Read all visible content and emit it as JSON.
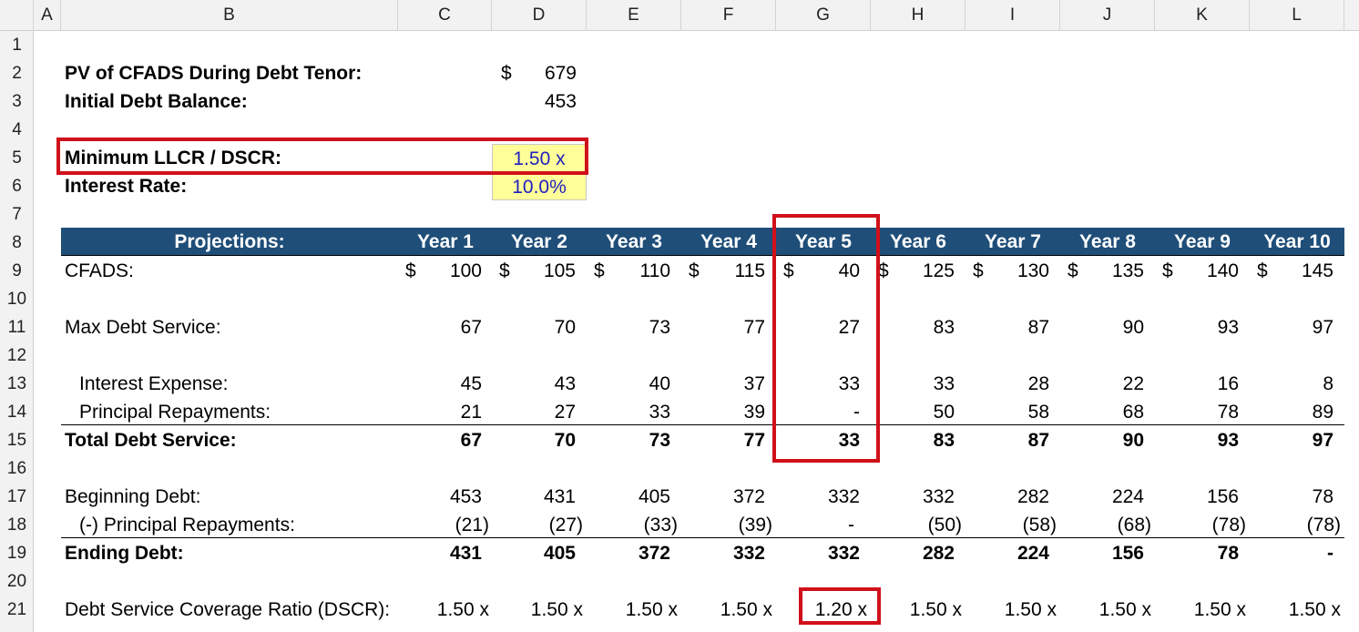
{
  "columns": [
    "A",
    "B",
    "C",
    "D",
    "E",
    "F",
    "G",
    "H",
    "I",
    "J",
    "K",
    "L"
  ],
  "rows": [
    "1",
    "2",
    "3",
    "4",
    "5",
    "6",
    "7",
    "8",
    "9",
    "10",
    "11",
    "12",
    "13",
    "14",
    "15",
    "16",
    "17",
    "18",
    "19",
    "20",
    "21"
  ],
  "summary": {
    "pv_label": "PV of CFADS During Debt Tenor:",
    "pv_currency": "$",
    "pv_value": "679",
    "initial_debt_label": "Initial Debt Balance:",
    "initial_debt_value": "453",
    "min_llcr_label": "Minimum LLCR / DSCR:",
    "min_llcr_value": "1.50 x",
    "interest_rate_label": "Interest Rate:",
    "interest_rate_value": "10.0%"
  },
  "projections_label": "Projections:",
  "years": [
    "Year 1",
    "Year 2",
    "Year 3",
    "Year 4",
    "Year 5",
    "Year 6",
    "Year 7",
    "Year 8",
    "Year 9",
    "Year 10"
  ],
  "currency_symbol": "$",
  "table": {
    "cfads": {
      "label": "CFADS:",
      "values": [
        "100",
        "105",
        "110",
        "115",
        "40",
        "125",
        "130",
        "135",
        "140",
        "145"
      ]
    },
    "max_debt_service": {
      "label": "Max Debt Service:",
      "values": [
        "67",
        "70",
        "73",
        "77",
        "27",
        "83",
        "87",
        "90",
        "93",
        "97"
      ]
    },
    "interest_expense": {
      "label": "Interest Expense:",
      "values": [
        "45",
        "43",
        "40",
        "37",
        "33",
        "33",
        "28",
        "22",
        "16",
        "8"
      ]
    },
    "principal_repayments": {
      "label": "Principal Repayments:",
      "values": [
        "21",
        "27",
        "33",
        "39",
        "-",
        "50",
        "58",
        "68",
        "78",
        "89"
      ]
    },
    "total_debt_service": {
      "label": "Total Debt Service:",
      "values": [
        "67",
        "70",
        "73",
        "77",
        "33",
        "83",
        "87",
        "90",
        "93",
        "97"
      ]
    },
    "beginning_debt": {
      "label": "Beginning Debt:",
      "values": [
        "453",
        "431",
        "405",
        "372",
        "332",
        "332",
        "282",
        "224",
        "156",
        "78"
      ]
    },
    "less_principal": {
      "label": "(-) Principal Repayments:",
      "values": [
        "(21)",
        "(27)",
        "(33)",
        "(39)",
        "-",
        "(50)",
        "(58)",
        "(68)",
        "(78)",
        "(78)"
      ]
    },
    "ending_debt": {
      "label": "Ending Debt:",
      "values": [
        "431",
        "405",
        "372",
        "332",
        "332",
        "282",
        "224",
        "156",
        "78",
        "-"
      ]
    },
    "dscr": {
      "label": "Debt Service Coverage Ratio (DSCR):",
      "values": [
        "1.50 x",
        "1.50 x",
        "1.50 x",
        "1.50 x",
        "1.20 x",
        "1.50 x",
        "1.50 x",
        "1.50 x",
        "1.50 x",
        "1.50 x"
      ]
    }
  },
  "colors": {
    "header_band": "#1f4e79",
    "highlight_red": "#d0101a",
    "input_yellow": "#ffff99",
    "input_blue": "#1f1fbf"
  }
}
